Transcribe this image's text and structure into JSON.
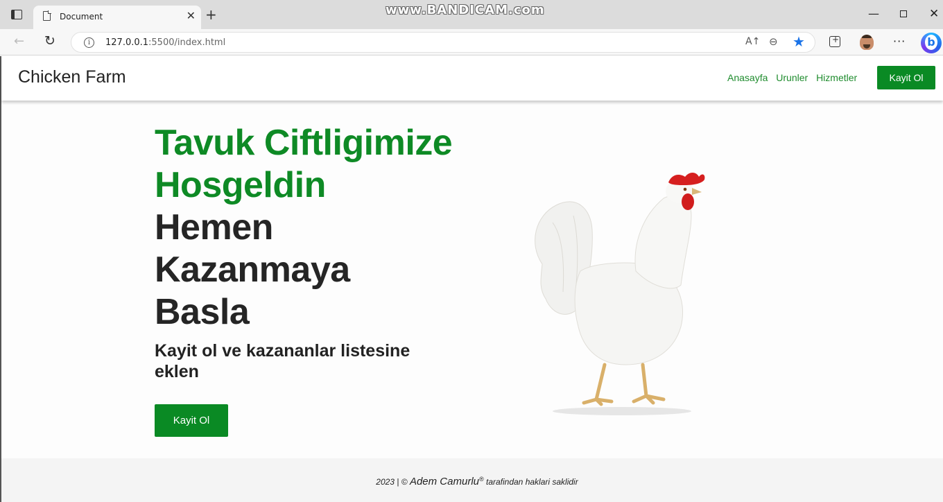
{
  "browser": {
    "tab_title": "Document",
    "url_host": "127.0.0.1",
    "url_rest": ":5500/index.html",
    "watermark": "www.BANDICAM.com",
    "accent_color": "#1a73e8"
  },
  "site": {
    "brand": "Chicken Farm",
    "nav": [
      "Anasayfa",
      "Urunler",
      "Hizmetler"
    ],
    "header_button": "Kayit Ol",
    "primary_color": "#0a8a24"
  },
  "hero": {
    "title_green_1": "Tavuk Ciftligimize",
    "title_green_2": "Hosgeldin",
    "title_dark_1": "Hemen",
    "title_dark_2": "Kazanmaya",
    "title_dark_3": "Basla",
    "subtitle": "Kayit ol ve kazananlar listesine eklen",
    "button": "Kayit Ol"
  },
  "footer": {
    "year_prefix": "2023 | ©",
    "author": "Adem Camurlu",
    "registered": "®",
    "suffix": "tarafindan haklari saklidir"
  }
}
